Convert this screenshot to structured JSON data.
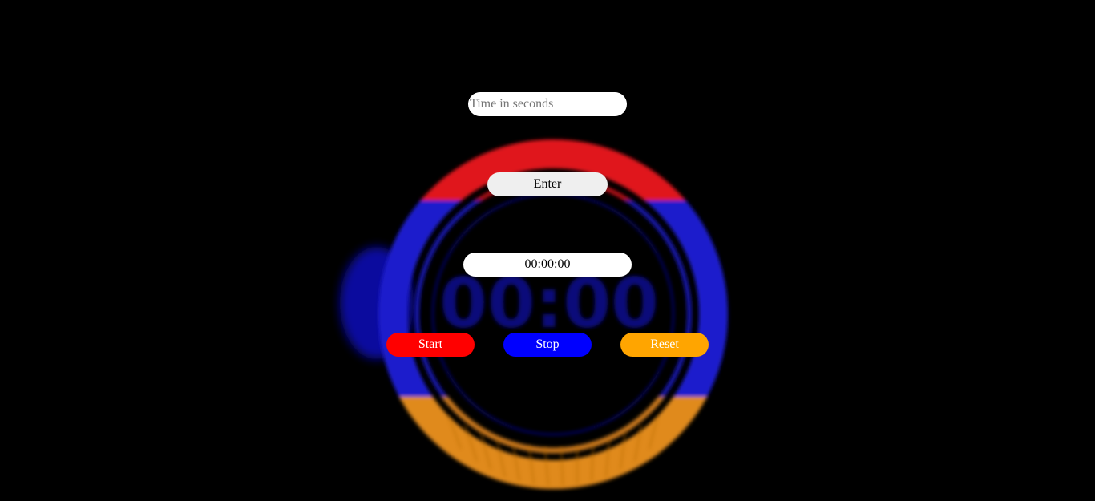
{
  "input": {
    "placeholder": "Time in seconds",
    "value": ""
  },
  "buttons": {
    "enter_label": "Enter",
    "start_label": "Start",
    "stop_label": "Stop",
    "reset_label": "Reset"
  },
  "display": {
    "time": "00:00:00"
  },
  "background_art": {
    "icon": "stopwatch-ring-graphic",
    "text": "00:00"
  },
  "colors": {
    "background": "#000000",
    "start": "#ff0000",
    "stop": "#0000ff",
    "reset": "#ffa500",
    "enter": "#efefef",
    "ring_red": "#e0141c",
    "ring_blue": "#1a1acc",
    "ring_orange": "#e08a1e"
  }
}
